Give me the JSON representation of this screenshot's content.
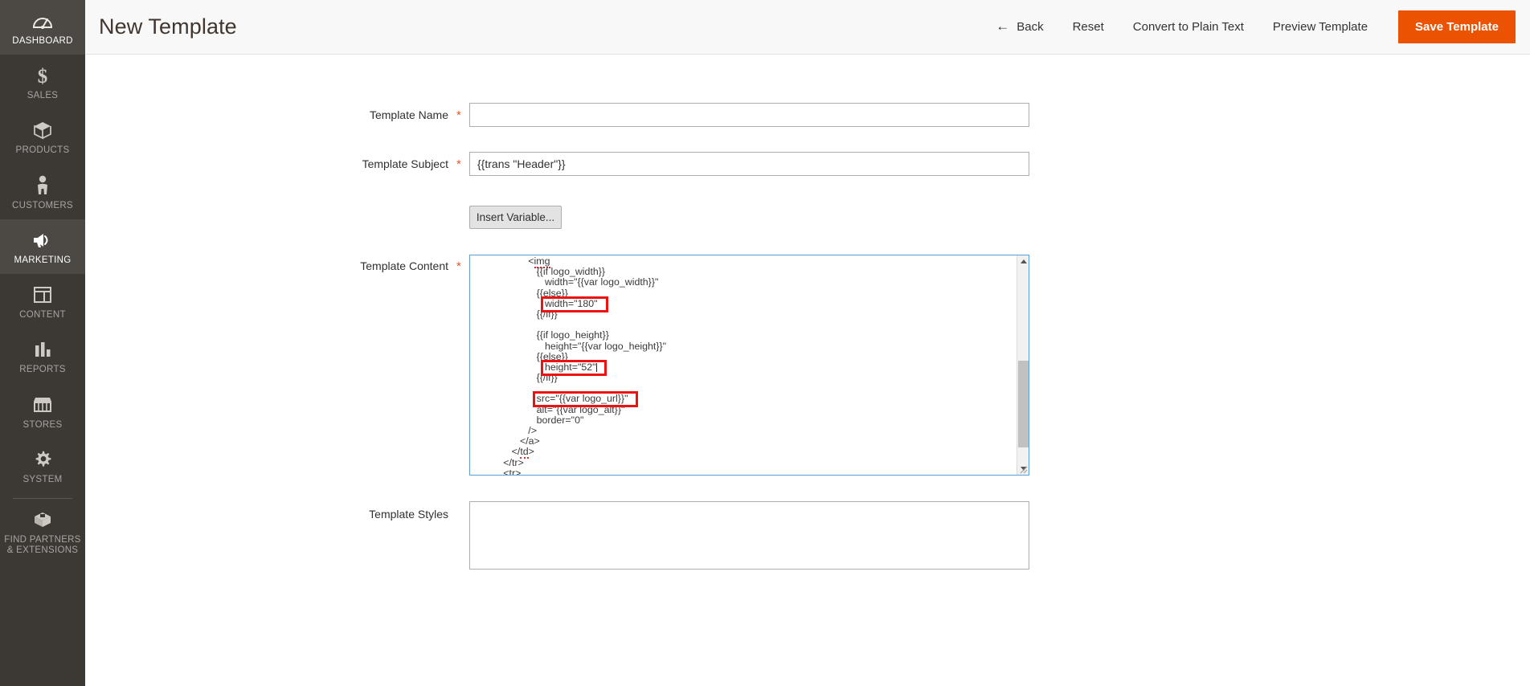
{
  "sidebar": {
    "items": [
      {
        "label": "DASHBOARD",
        "icon": "dashboard-gauge-icon",
        "active": false,
        "name": "sidebar-item-dashboard"
      },
      {
        "label": "SALES",
        "icon": "dollar-sign-icon",
        "active": false,
        "name": "sidebar-item-sales"
      },
      {
        "label": "PRODUCTS",
        "icon": "box-icon",
        "active": false,
        "name": "sidebar-item-products"
      },
      {
        "label": "CUSTOMERS",
        "icon": "person-icon",
        "active": false,
        "name": "sidebar-item-customers"
      },
      {
        "label": "MARKETING",
        "icon": "megaphone-icon",
        "active": true,
        "name": "sidebar-item-marketing"
      },
      {
        "label": "CONTENT",
        "icon": "layout-page-icon",
        "active": false,
        "name": "sidebar-item-content"
      },
      {
        "label": "REPORTS",
        "icon": "bar-chart-icon",
        "active": false,
        "name": "sidebar-item-reports"
      },
      {
        "label": "STORES",
        "icon": "storefront-icon",
        "active": false,
        "name": "sidebar-item-stores"
      },
      {
        "label": "SYSTEM",
        "icon": "gear-icon",
        "active": false,
        "name": "sidebar-item-system"
      },
      {
        "label": "FIND PARTNERS\n& EXTENSIONS",
        "icon": "extension-box-icon",
        "active": false,
        "name": "sidebar-item-find-partners"
      }
    ]
  },
  "header": {
    "title": "New Template",
    "actions": {
      "back": "Back",
      "reset": "Reset",
      "convert": "Convert to Plain Text",
      "preview": "Preview Template",
      "save": "Save Template"
    }
  },
  "form": {
    "template_name": {
      "label": "Template Name",
      "required": "*",
      "value": "",
      "placeholder": ""
    },
    "template_subject": {
      "label": "Template Subject",
      "required": "*",
      "value": "{{trans \"Header\"}}",
      "placeholder": ""
    },
    "insert_variable_button": "Insert Variable...",
    "template_content": {
      "label": "Template Content",
      "required": "*",
      "lines": [
        "                     <img",
        "                        {{if logo_width}}",
        "                           width=\"{{var logo_width}}\"",
        "                        {{else}}",
        "                           width=\"180\"",
        "                        {{/if}}",
        "",
        "                        {{if logo_height}}",
        "                           height=\"{{var logo_height}}\"",
        "                        {{else}}",
        "                           height=\"52\"",
        "                        {{/if}}",
        "",
        "                        src=\"{{var logo_url}}\"",
        "                        alt=\"{{var logo_alt}}\"",
        "                        border=\"0\"",
        "                     />",
        "                  </a>",
        "               </td>",
        "            </tr>",
        "            <tr>"
      ],
      "highlights": [
        {
          "name": "highlight-width-180",
          "text": "width=\"180\""
        },
        {
          "name": "highlight-height-52",
          "text": "height=\"52\""
        },
        {
          "name": "highlight-src-logo-url",
          "text": "src=\"{{var logo_url}}\""
        }
      ]
    },
    "template_styles": {
      "label": "Template Styles",
      "value": "",
      "placeholder": ""
    }
  },
  "colors": {
    "sidebar_bg": "#3c3935",
    "sidebar_active_bg": "#4c4844",
    "accent_orange": "#eb5202",
    "required_star": "#e65722",
    "focus_border": "#5a9fd4",
    "highlight_red": "#ee1111",
    "header_bg": "#f8f8f8"
  }
}
